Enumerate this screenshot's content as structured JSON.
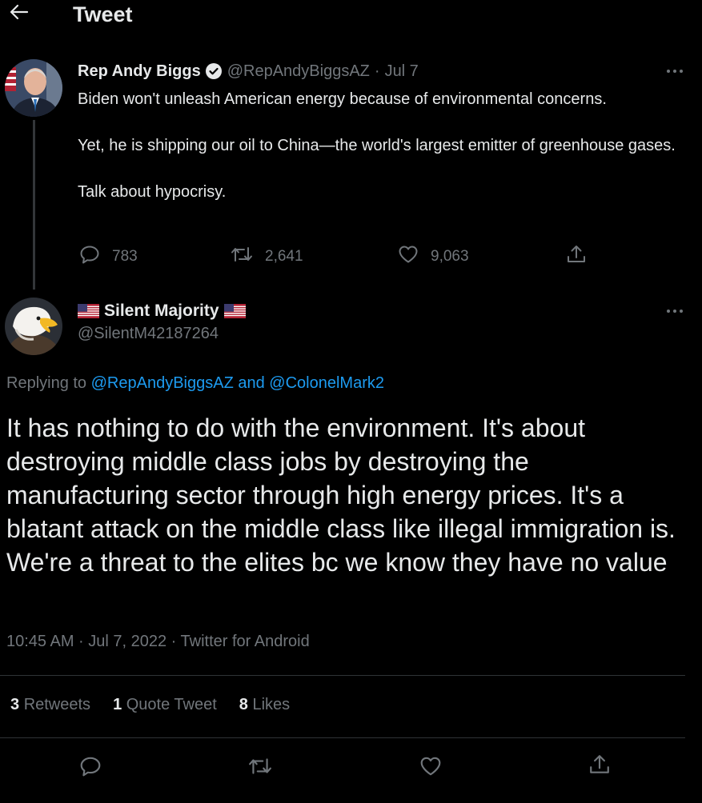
{
  "header": {
    "title": "Tweet",
    "back_icon": "arrow-left-icon"
  },
  "parent_tweet": {
    "author_name": "Rep Andy Biggs",
    "verified_icon": "verified-badge-icon",
    "handle": "@RepAndyBiggsAZ",
    "separator": "·",
    "date": "Jul 7",
    "paragraphs": [
      "Biden won't unleash American energy because of environmental concerns.",
      "Yet, he is shipping our oil to China—the world's largest emitter of greenhouse gases.",
      "Talk about hypocrisy."
    ],
    "replies": "783",
    "retweets": "2,641",
    "likes": "9,063"
  },
  "reply_tweet": {
    "flag_left": "🇺🇸",
    "author_name": "Silent Majority",
    "flag_right": "🇺🇸",
    "handle": "@SilentM42187264",
    "replying_prefix": "Replying to",
    "replying_user_1": "@RepAndyBiggsAZ",
    "replying_and": "and",
    "replying_user_2": "@ColonelMark2",
    "text": "It has nothing to do with the environment. It's about destroying middle class jobs by destroying the manufacturing sector through high energy prices. It's a blatant attack on the middle class like illegal immigration is. We're a threat to the elites bc we know they have no value",
    "timestamp": "10:45 AM · Jul 7, 2022 · Twitter for Android",
    "stats": {
      "retweets_count": "3",
      "retweets_label": "Retweets",
      "quotes_count": "1",
      "quotes_label": "Quote Tweet",
      "likes_count": "8",
      "likes_label": "Likes"
    }
  },
  "colors": {
    "background": "#000000",
    "text": "#e7e9ea",
    "muted": "#71767b",
    "link": "#1d9bf0",
    "divider": "#2f3336"
  }
}
